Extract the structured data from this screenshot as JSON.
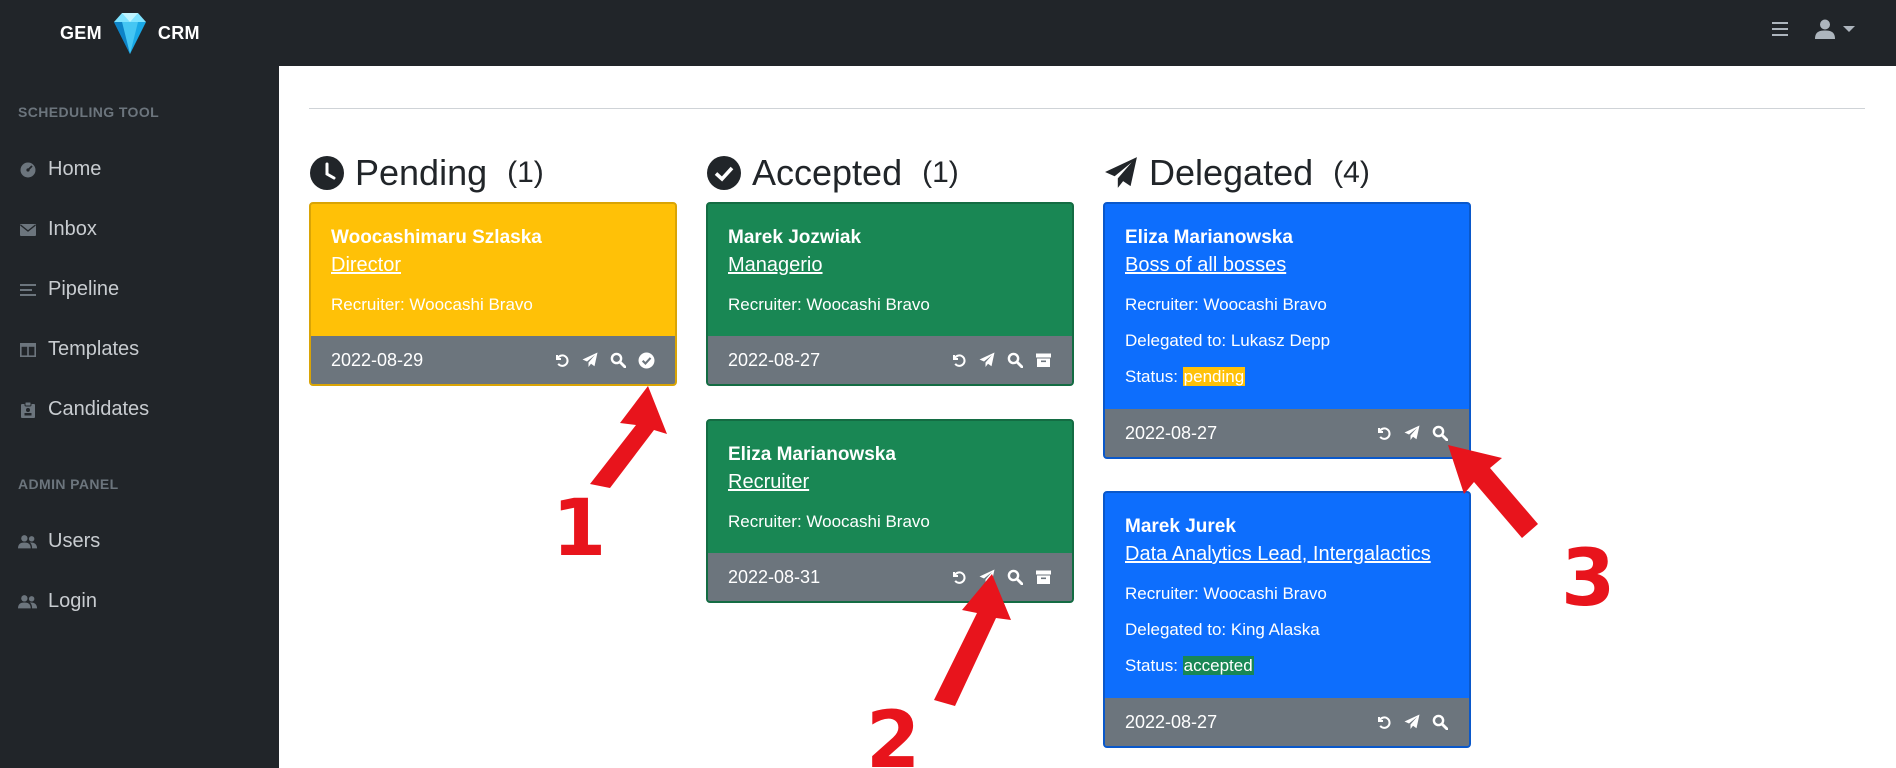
{
  "brand": {
    "left": "GEM",
    "right": "CRM"
  },
  "header": {
    "menu_icon": "bars-icon",
    "user_icon": "user-icon"
  },
  "sidebar": {
    "sections": [
      {
        "heading": "SCHEDULING TOOL",
        "items": [
          {
            "label": "Home",
            "icon": "dashboard-icon"
          },
          {
            "label": "Inbox",
            "icon": "envelope-icon"
          },
          {
            "label": "Pipeline",
            "icon": "list-icon"
          },
          {
            "label": "Templates",
            "icon": "columns-icon"
          },
          {
            "label": "Candidates",
            "icon": "clipboard-icon"
          }
        ]
      },
      {
        "heading": "ADMIN PANEL",
        "items": [
          {
            "label": "Users",
            "icon": "users-icon"
          },
          {
            "label": "Login",
            "icon": "users-icon"
          }
        ]
      }
    ]
  },
  "columns": [
    {
      "title": "Pending",
      "count": "(1)",
      "icon": "clock-icon",
      "cards": [
        {
          "name": "Woocashimaru Szlaska",
          "position": "Director",
          "recruiter": "Recruiter: Woocashi Bravo",
          "date": "2022-08-29",
          "color": "#ffc107",
          "actions": [
            "undo-icon",
            "send-icon",
            "search-icon",
            "check-circle-icon"
          ]
        }
      ]
    },
    {
      "title": "Accepted",
      "count": "(1)",
      "icon": "check-circle-icon",
      "cards": [
        {
          "name": "Marek Jozwiak",
          "position": "Managerio",
          "recruiter": "Recruiter: Woocashi Bravo",
          "date": "2022-08-27",
          "color": "#198754",
          "actions": [
            "undo-icon",
            "send-icon",
            "search-icon",
            "archive-icon"
          ]
        },
        {
          "name": "Eliza Marianowska",
          "position": "Recruiter",
          "recruiter": "Recruiter: Woocashi Bravo",
          "date": "2022-08-31",
          "color": "#198754",
          "actions": [
            "undo-icon",
            "send-icon",
            "search-icon",
            "archive-icon"
          ]
        }
      ]
    },
    {
      "title": "Delegated",
      "count": "(4)",
      "icon": "paper-plane-icon",
      "cards": [
        {
          "name": "Eliza Marianowska",
          "position": "Boss of all bosses",
          "recruiter": "Recruiter: Woocashi Bravo",
          "delegated": "Delegated to: Lukasz Depp",
          "status_label": "Status:",
          "status": "pending",
          "date": "2022-08-27",
          "color": "#0d6efd",
          "actions": [
            "undo-icon",
            "send-icon",
            "search-icon"
          ]
        },
        {
          "name": "Marek Jurek",
          "position": "Data Analytics Lead, Intergalactics",
          "recruiter": "Recruiter: Woocashi Bravo",
          "delegated": "Delegated to: King Alaska",
          "status_label": "Status:",
          "status": "accepted",
          "date": "2022-08-27",
          "color": "#0d6efd",
          "actions": [
            "undo-icon",
            "send-icon",
            "search-icon"
          ]
        }
      ]
    }
  ],
  "annotations": [
    {
      "number": "1",
      "color": "#e8141c"
    },
    {
      "number": "2",
      "color": "#e8141c"
    },
    {
      "number": "3",
      "color": "#e8141c"
    }
  ]
}
